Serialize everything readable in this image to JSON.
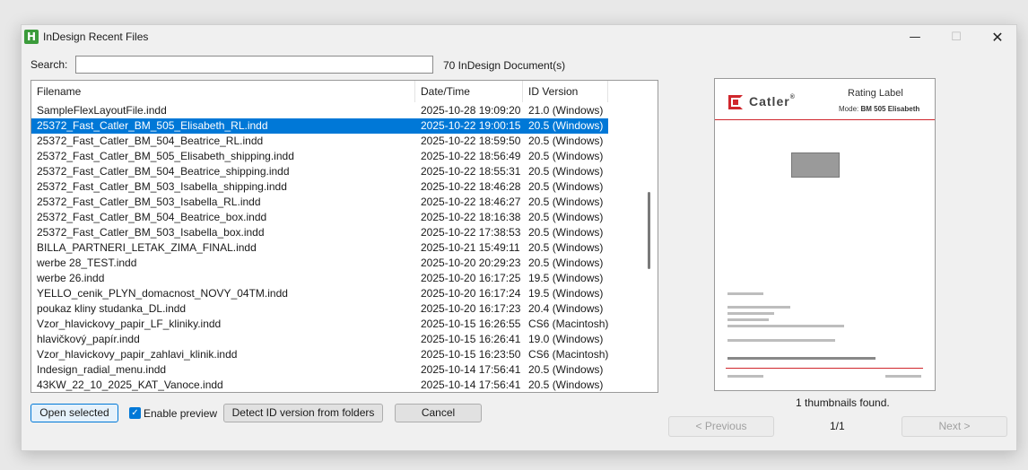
{
  "window": {
    "app_icon_letter": "H",
    "title": "InDesign Recent Files",
    "minimize": "—",
    "maximize": "☐",
    "close": "✕"
  },
  "search": {
    "label": "Search:",
    "value": "",
    "count_text": "70 InDesign Document(s)"
  },
  "table": {
    "columns": [
      "Filename",
      "Date/Time",
      "ID Version"
    ],
    "selected_index": 1,
    "rows": [
      [
        "SampleFlexLayoutFile.indd",
        "2025-10-28 19:09:20",
        "21.0 (Windows)"
      ],
      [
        "25372_Fast_Catler_BM_505_Elisabeth_RL.indd",
        "2025-10-22 19:00:15",
        "20.5 (Windows)"
      ],
      [
        "25372_Fast_Catler_BM_504_Beatrice_RL.indd",
        "2025-10-22 18:59:50",
        "20.5 (Windows)"
      ],
      [
        "25372_Fast_Catler_BM_505_Elisabeth_shipping.indd",
        "2025-10-22 18:56:49",
        "20.5 (Windows)"
      ],
      [
        "25372_Fast_Catler_BM_504_Beatrice_shipping.indd",
        "2025-10-22 18:55:31",
        "20.5 (Windows)"
      ],
      [
        "25372_Fast_Catler_BM_503_Isabella_shipping.indd",
        "2025-10-22 18:46:28",
        "20.5 (Windows)"
      ],
      [
        "25372_Fast_Catler_BM_503_Isabella_RL.indd",
        "2025-10-22 18:46:27",
        "20.5 (Windows)"
      ],
      [
        "25372_Fast_Catler_BM_504_Beatrice_box.indd",
        "2025-10-22 18:16:38",
        "20.5 (Windows)"
      ],
      [
        "25372_Fast_Catler_BM_503_Isabella_box.indd",
        "2025-10-22 17:38:53",
        "20.5 (Windows)"
      ],
      [
        "BILLA_PARTNERI_LETAK_ZIMA_FINAL.indd",
        "2025-10-21 15:49:11",
        "20.5 (Windows)"
      ],
      [
        "werbe 28_TEST.indd",
        "2025-10-20 20:29:23",
        "20.5 (Windows)"
      ],
      [
        "werbe 26.indd",
        "2025-10-20 16:17:25",
        "19.5 (Windows)"
      ],
      [
        "YELLO_cenik_PLYN_domacnost_NOVY_04TM.indd",
        "2025-10-20 16:17:24",
        "19.5 (Windows)"
      ],
      [
        "poukaz kliny studanka_DL.indd",
        "2025-10-20 16:17:23",
        "20.4 (Windows)"
      ],
      [
        "Vzor_hlavickovy_papir_LF_kliniky.indd",
        "2025-10-15 16:26:55",
        "CS6 (Macintosh)"
      ],
      [
        "hlavičkový_papír.indd",
        "2025-10-15 16:26:41",
        "19.0 (Windows)"
      ],
      [
        "Vzor_hlavickovy_papir_zahlavi_klinik.indd",
        "2025-10-15 16:23:50",
        "CS6 (Macintosh)"
      ],
      [
        "Indesign_radial_menu.indd",
        "2025-10-14 17:56:41",
        "20.5 (Windows)"
      ],
      [
        "43KW_22_10_2025_KAT_Vanoce.indd",
        "2025-10-14 17:56:41",
        "20.5 (Windows)"
      ]
    ]
  },
  "actions": {
    "open_selected": "Open selected",
    "enable_preview_label": "Enable preview",
    "enable_preview_checked": true,
    "detect": "Detect ID version from folders",
    "cancel": "Cancel"
  },
  "preview": {
    "logo_text": "Catler",
    "logo_registered": "®",
    "doc_title": "Rating Label",
    "doc_mode_prefix": "Mode:",
    "doc_mode_value": "BM 505 Elisabeth",
    "thumb_count": "1 thumbnails found.",
    "prev_label": "< Previous",
    "next_label": "Next >",
    "page_indicator": "1/1"
  },
  "colors": {
    "selection": "#0078d7",
    "catler_red": "#d0262c",
    "app_icon_green": "#3b9b3b"
  }
}
